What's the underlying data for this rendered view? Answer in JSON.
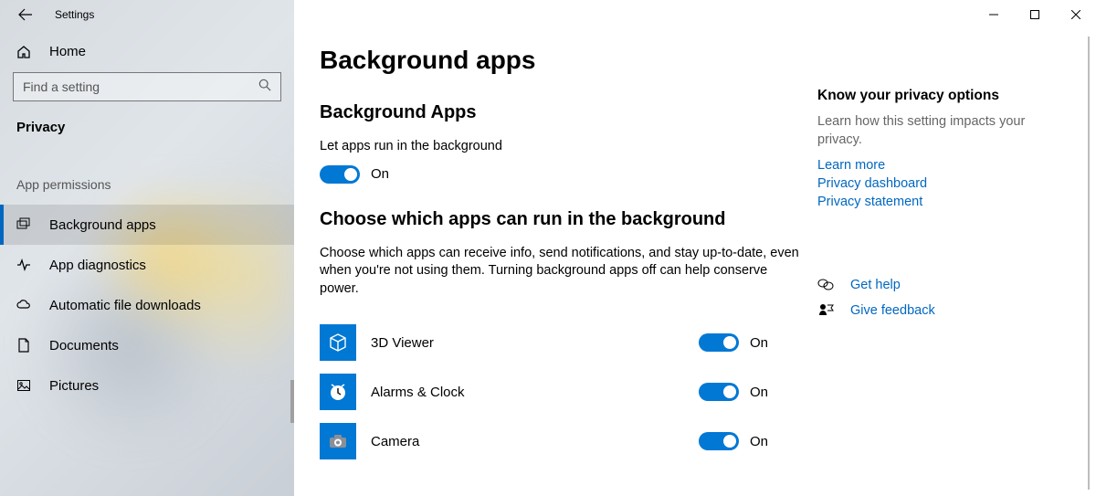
{
  "titlebar": {
    "title": "Settings"
  },
  "sidebar": {
    "home": "Home",
    "search_placeholder": "Find a setting",
    "category": "Privacy",
    "group": "App permissions",
    "items": [
      {
        "id": "background-apps",
        "label": "Background apps",
        "selected": true
      },
      {
        "id": "app-diagnostics",
        "label": "App diagnostics",
        "selected": false
      },
      {
        "id": "auto-downloads",
        "label": "Automatic file downloads",
        "selected": false
      },
      {
        "id": "documents",
        "label": "Documents",
        "selected": false
      },
      {
        "id": "pictures",
        "label": "Pictures",
        "selected": false
      }
    ]
  },
  "main": {
    "title": "Background apps",
    "section1": {
      "heading": "Background Apps",
      "desc": "Let apps run in the background",
      "state_label": "On"
    },
    "section2": {
      "heading": "Choose which apps can run in the background",
      "desc": "Choose which apps can receive info, send notifications, and stay up-to-date, even when you're not using them. Turning background apps off can help conserve power."
    },
    "apps": [
      {
        "name": "3D Viewer",
        "state": "On"
      },
      {
        "name": "Alarms & Clock",
        "state": "On"
      },
      {
        "name": "Camera",
        "state": "On"
      }
    ]
  },
  "right": {
    "heading": "Know your privacy options",
    "desc": "Learn how this setting impacts your privacy.",
    "links": [
      "Learn more",
      "Privacy dashboard",
      "Privacy statement"
    ],
    "help": "Get help",
    "feedback": "Give feedback"
  }
}
